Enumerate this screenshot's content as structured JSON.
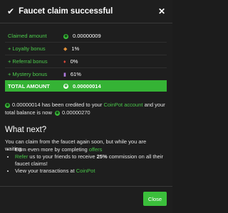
{
  "header": {
    "title": "Faucet claim successful",
    "close_symbol": "✕"
  },
  "summary": {
    "rows": [
      {
        "label": "Claimed amount",
        "value": "0.00000009",
        "prefix": "",
        "icon": "coin-icon"
      },
      {
        "label": "Loyalty bonus",
        "value": "1%",
        "prefix": "+",
        "icon": "loyalty-badge-icon"
      },
      {
        "label": "Referral bonus",
        "value": "0%",
        "prefix": "+",
        "icon": "referral-gem-icon"
      },
      {
        "label": "Mystery bonus",
        "value": "61%",
        "prefix": "+",
        "icon": "mystery-potion-icon"
      }
    ],
    "total": {
      "label": "TOTAL AMOUNT",
      "value": "0.00000014"
    }
  },
  "message": {
    "amount": "0.00000014",
    "text1": " has been credited to your ",
    "link": "CoinPot account",
    "text2": " and your total balance is now ",
    "balance": "0.00000270"
  },
  "next": {
    "heading": "What next?",
    "intro": "You can claim from the faucet again soon, but while you are waiting...",
    "item1_text": "Earn even more by completing ",
    "item1_link": "offers",
    "item2_link": "Refer",
    "item2_text_a": " us to your friends to receive ",
    "item2_bold": "25%",
    "item2_text_b": " commission on all their faucet claims!",
    "item3_text": "View your transactions at ",
    "item3_link": "CoinPot"
  },
  "footer": {
    "close_label": "Close"
  },
  "colors": {
    "accent": "#3bbf3b",
    "background": "#1e1e1e"
  }
}
